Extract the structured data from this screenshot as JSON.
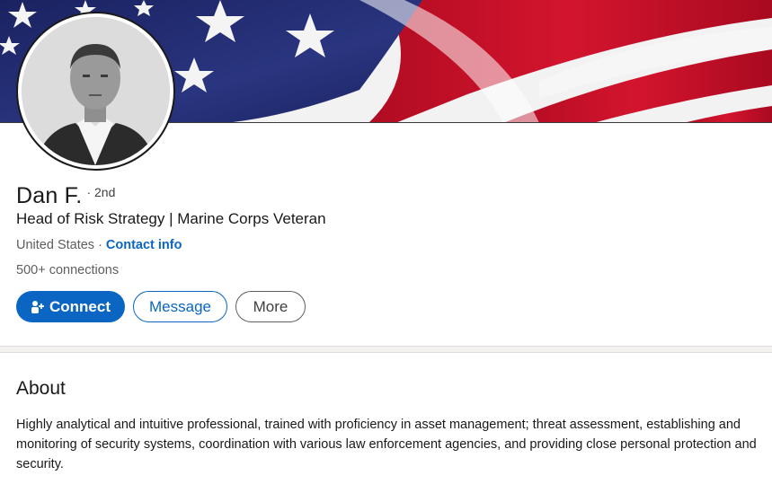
{
  "profile": {
    "name": "Dan F.",
    "degree": "· 2nd",
    "headline": "Head of Risk Strategy | Marine Corps Veteran",
    "location": "United States",
    "separator": "·",
    "contact_info": "Contact info",
    "connections": "500+ connections"
  },
  "actions": {
    "connect_label": "Connect",
    "message_label": "Message",
    "more_label": "More"
  },
  "about": {
    "title": "About",
    "text": "Highly analytical and intuitive professional, trained with proficiency in asset management; threat assessment, establishing and monitoring of security systems, coordination with various law enforcement agencies, and providing close personal protection and security."
  },
  "icons": {
    "connect": "add-person-icon"
  },
  "colors": {
    "accent": "#0a66c2",
    "banner_blue": "#1f2a6b",
    "banner_red": "#c8102e"
  }
}
